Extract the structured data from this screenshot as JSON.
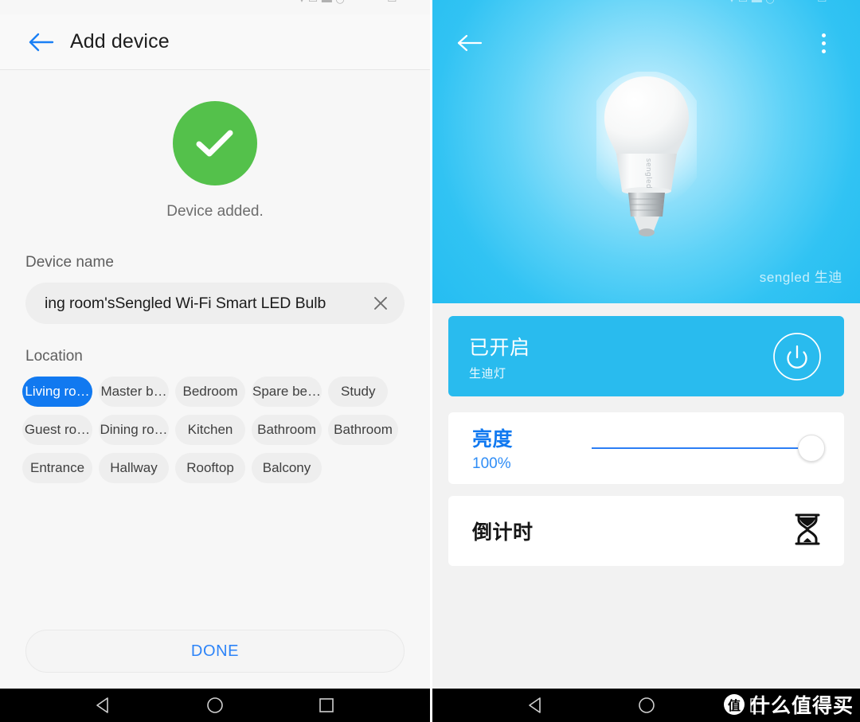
{
  "left_phone": {
    "status_bar": {
      "icons": "▾ ▭ ▬ ◡ ⋯   ⋯⋯ ▭ ⋯⋯"
    },
    "header": {
      "back_icon": "back-arrow-icon",
      "title": "Add device"
    },
    "success": {
      "icon": "check-circle-icon",
      "message": "Device added.",
      "color": "#54c14b"
    },
    "device_name": {
      "label": "Device name",
      "value": "ing room'sSengled Wi-Fi Smart LED Bulb",
      "placeholder": "Device name",
      "clear_icon": "close-icon"
    },
    "location": {
      "label": "Location",
      "selected": "Living ro…",
      "accent": "#1179f0",
      "chips": [
        "Living ro…",
        "Master b…",
        "Bedroom",
        "Spare be…",
        "Study",
        "Guest ro…",
        "Dining ro…",
        "Kitchen",
        "Bathroom",
        "Bathroom",
        "Entrance",
        "Hallway",
        "Rooftop",
        "Balcony"
      ]
    },
    "done_button": {
      "label": "DONE",
      "color": "#2d84f8"
    },
    "nav_bar": {
      "back": "nav-back-icon",
      "home": "nav-home-icon",
      "recents": "nav-recents-icon"
    }
  },
  "right_phone": {
    "status_bar": {
      "icons": "▾ ▭ ▬ ◡ ⋯   ⋯⋯ ▭ ⋯⋯"
    },
    "top_bar": {
      "back_icon": "back-arrow-icon",
      "menu_icon": "more-vertical-icon"
    },
    "hero": {
      "product_image": "led-bulb-image",
      "brand_watermark": "sengled 生迪",
      "background_color": "#31c3f3"
    },
    "power_card": {
      "state": "已开启",
      "device": "生迪灯",
      "power_icon": "power-icon",
      "background": "#29bbee"
    },
    "brightness_card": {
      "label": "亮度",
      "value": "100%",
      "percent": 100,
      "accent": "#1179f0"
    },
    "timer_card": {
      "label": "倒计时",
      "icon": "hourglass-icon"
    },
    "nav_bar": {
      "back": "nav-back-icon",
      "home": "nav-home-icon",
      "recents": "nav-recents-icon"
    },
    "watermark": {
      "logo": "值",
      "text": "什么值得买"
    }
  }
}
